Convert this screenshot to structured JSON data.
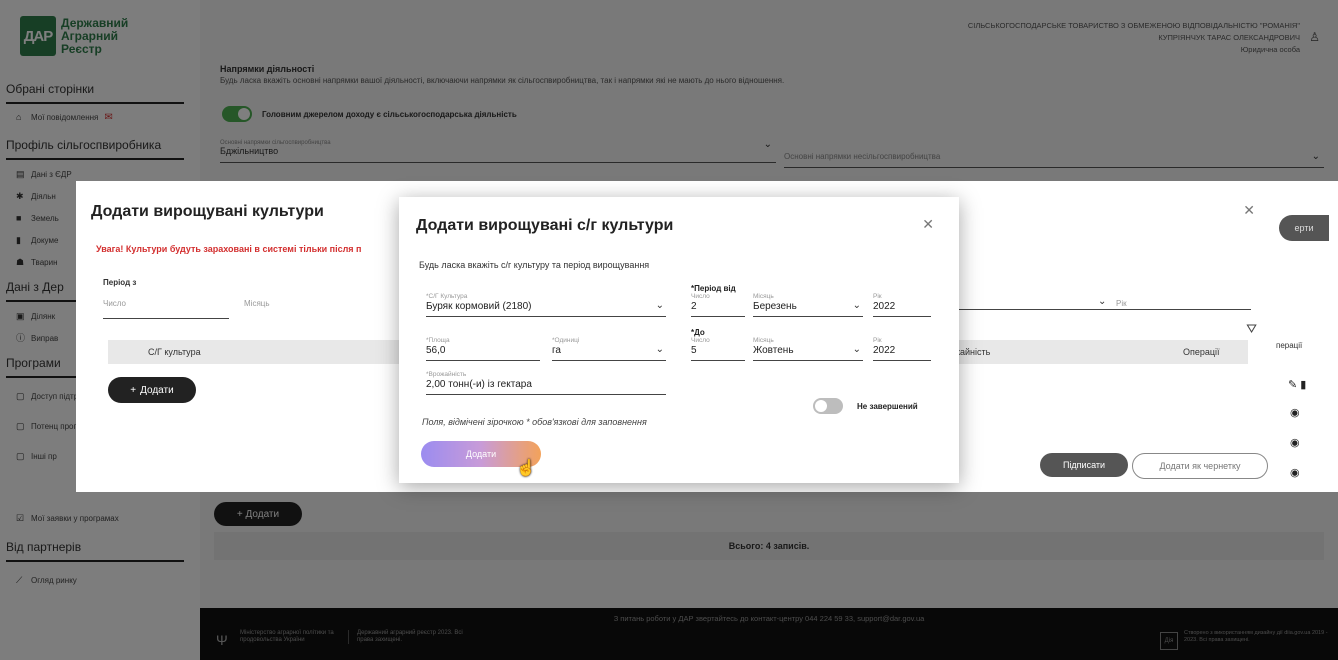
{
  "app": {
    "logo_mark": "ДАР",
    "logo_line1": "Державний",
    "logo_line2": "Аграрний",
    "logo_line3": "Реєстр"
  },
  "header": {
    "org_name": "СІЛЬСЬКОГОСПОДАРСЬКЕ ТОВАРИСТВО З ОБМЕЖЕНОЮ ВІДПОВІДАЛЬНІСТЮ \"РОМАНІЯ\"",
    "user_name": "КУПРІЯНЧУК ТАРАС ОЛЕКСАНДРОВИЧ",
    "user_role": "Юридична особа"
  },
  "sidebar": {
    "fav_title": "Обрані сторінки",
    "my_messages": "Мої повідомлення",
    "profile_title": "Профіль сільгоспвиробника",
    "items": [
      "Дані з ЄДР",
      "Діяльн",
      "Земель",
      "Докуме",
      "Тварин"
    ],
    "registry_title": "Дані з Дер",
    "registry_items": [
      "Ділянк",
      "Виправ"
    ],
    "programs_title": "Програми",
    "program_items": [
      "Доступ підтрим",
      "Потенц програ",
      "Інші пр",
      "Мої заявки у програмах"
    ],
    "partners_title": "Від партнерів",
    "partner_items": [
      "Огляд ринку"
    ]
  },
  "background": {
    "section_title": "Напрямки діяльності",
    "section_desc": "Будь ласка вкажіть основні напрямки вашої діяльності, включаючи напрямки як сільгоспвиробництва, так і напрямки які не мають до нього відношення.",
    "toggle_label": "Головним джерелом доходу є сільськогосподарська діяльність",
    "field1_label": "Основні напрямки сільгоспвиробництва",
    "field1_value": "Бджільництво",
    "field2_label": "Основні напрямки несільгоспвиробництва",
    "add_label": "+ Додати",
    "total": "Всього: 4 записів."
  },
  "back_dialog": {
    "title": "Додати вирощувані культури",
    "warning": "Увага! Культури будуть зараховані в системі тільки після п",
    "period_label": "Період з",
    "num_placeholder": "Число",
    "month_placeholder": "Місяць",
    "year_placeholder": "Рік",
    "col_crop": "С/Г культура",
    "col_yield": "жайність",
    "col_ops": "Операції",
    "ops_side": "перації",
    "add_label": "Додати",
    "sign_label": "Підписати",
    "draft_label": "Додати як чернетку",
    "behind_btn": "ерти"
  },
  "front_dialog": {
    "title": "Додати вирощувані с/г культури",
    "subtitle": "Будь ласка вкажіть с/г культуру та період вирощування",
    "crop_label": "*С/Г Культура",
    "crop_value": "Буряк кормовий (2180)",
    "from_group": "*Період від",
    "from_num_label": "Число",
    "from_num_value": "2",
    "from_month_label": "Місяць",
    "from_month_value": "Березень",
    "from_year_label": "Рік",
    "from_year_value": "2022",
    "area_label": "*Площа",
    "area_value": "56,0",
    "unit_label": "*Одиниці",
    "unit_value": "га",
    "to_group": "*До",
    "to_num_label": "Число",
    "to_num_value": "5",
    "to_month_label": "Місяць",
    "to_month_value": "Жовтень",
    "to_year_label": "Рік",
    "to_year_value": "2022",
    "yield_label": "*Врожайність",
    "yield_value": "2,00 тонн(-и) із гектара",
    "unfinished_label": "Не завершений",
    "required_note": "Поля, відмічені зірочкою * обов'язкові для заповнення",
    "submit_label": "Додати"
  },
  "footer": {
    "contact": "З питань роботи у ДАР звертайтесь до контакт-центру 044 224 59 33, support@dar.gov.ua",
    "ministry": "Міністерство аграрної політики та продовольства України",
    "dar": "Державний аграрний реєстр 2023. Всі права захищені.",
    "diia_mark": "Дія",
    "diia": "Створено з використанням дизайну дії diia.gov.ua 2019 - 2023. Всі права захищені."
  },
  "colors": {
    "brand_green": "#2f7d4a",
    "warning_red": "#d32f2f",
    "toggle_on": "#4caf50"
  }
}
